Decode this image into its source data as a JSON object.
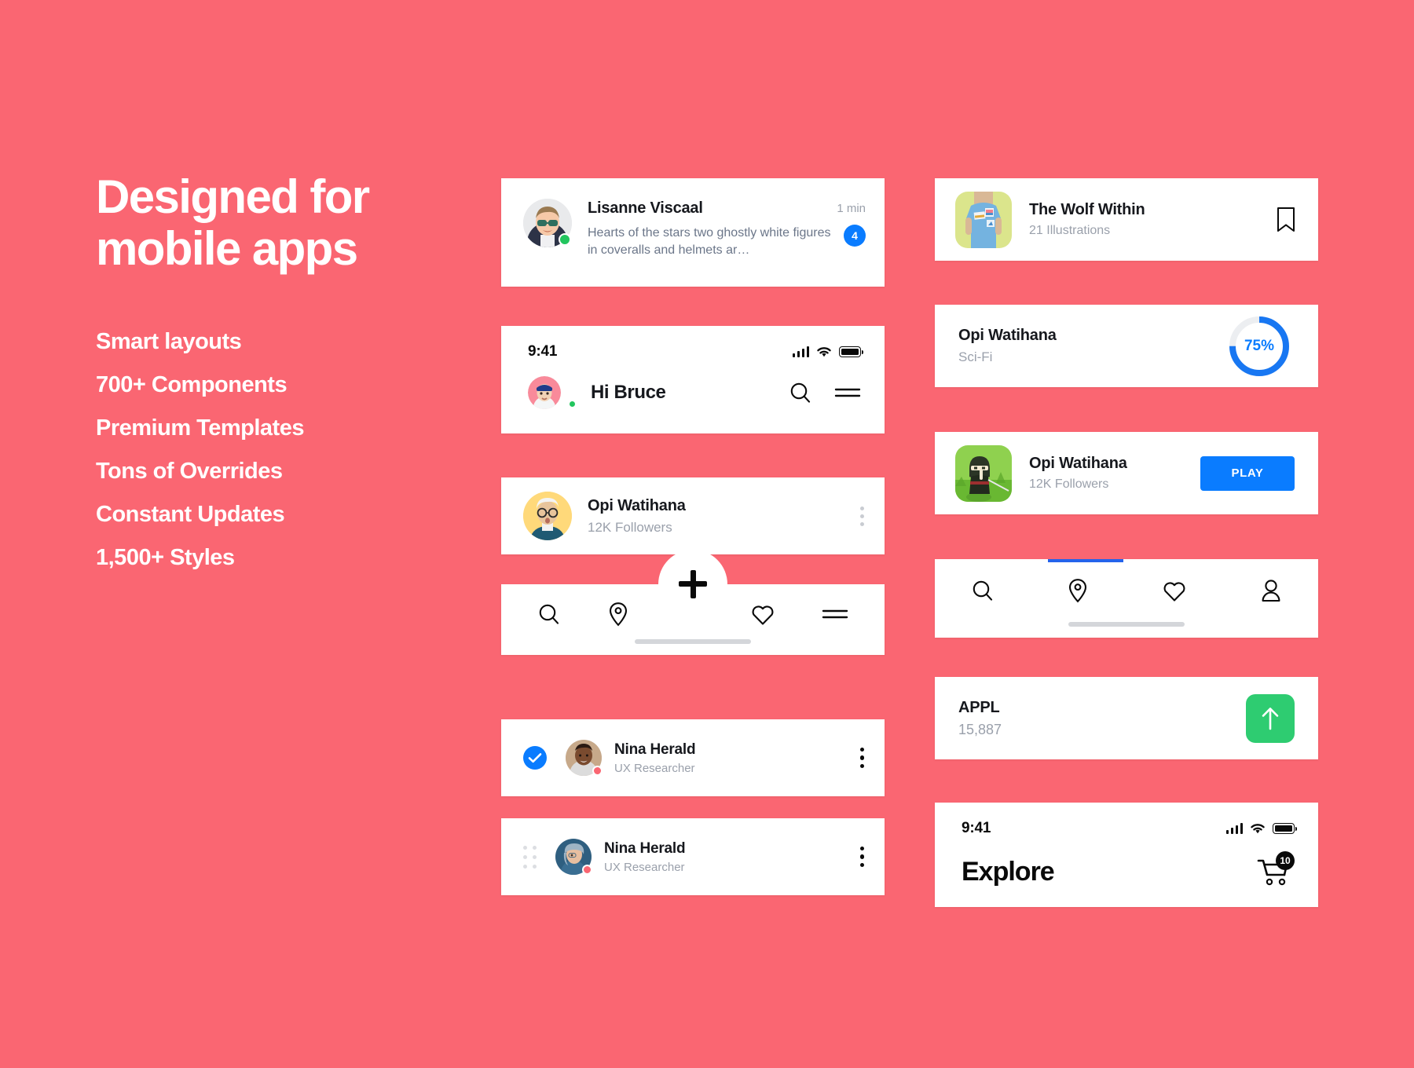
{
  "theme": {
    "background": "#fa6672",
    "card_bg": "#ffffff",
    "accent_blue": "#0a7cff",
    "accent_green": "#2ecc71",
    "text_dark": "#16181d",
    "text_muted": "#9aa0ab"
  },
  "promo": {
    "title": "Designed for\nmobile apps",
    "features": [
      "Smart layouts",
      "700+ Components",
      "Premium Templates",
      "Tons of Overrides",
      "Constant Updates",
      "1,500+ Styles"
    ]
  },
  "message_card": {
    "name": "Lisanne Viscaal",
    "preview": "Hearts of the stars two ghostly white figures in coveralls and helmets ar…",
    "time": "1 min",
    "unread": "4",
    "status": "online"
  },
  "header_card": {
    "time": "9:41",
    "greeting": "Hi Bruce",
    "search_icon": "search-icon",
    "menu_icon": "hamburger-icon"
  },
  "follower_card": {
    "name": "Opi Watihana",
    "followers": "12K Followers",
    "more_icon": "kebab-menu-icon"
  },
  "tabbar_fab": {
    "items": [
      "search-icon",
      "location-pin-icon",
      "heart-icon",
      "hamburger-icon"
    ],
    "fab_icon": "plus-icon"
  },
  "list_items": [
    {
      "name": "Nina Herald",
      "role": "UX Researcher",
      "leading": "checkmark-circle",
      "more_icon": "kebab-menu-icon"
    },
    {
      "name": "Nina Herald",
      "role": "UX Researcher",
      "leading": "drag-handle",
      "more_icon": "kebab-menu-icon"
    }
  ],
  "book_card": {
    "title": "The Wolf Within",
    "subtitle": "21 Illustrations",
    "action_icon": "bookmark-icon"
  },
  "progress_card": {
    "title": "Opi Watihana",
    "subtitle": "Sci-Fi",
    "percent_label": "75%",
    "percent_value": 75
  },
  "play_card": {
    "title": "Opi Watihana",
    "subtitle": "12K Followers",
    "button_label": "PLAY"
  },
  "tabbar_right": {
    "items": [
      "search-icon",
      "location-pin-icon",
      "heart-icon",
      "person-icon"
    ],
    "active_index": 1
  },
  "stock_card": {
    "symbol": "APPL",
    "value": "15,887",
    "trend_icon": "arrow-up-icon",
    "trend": "up"
  },
  "explore_card": {
    "time": "9:41",
    "title": "Explore",
    "cart_icon": "shopping-cart-icon",
    "cart_count": "10"
  }
}
